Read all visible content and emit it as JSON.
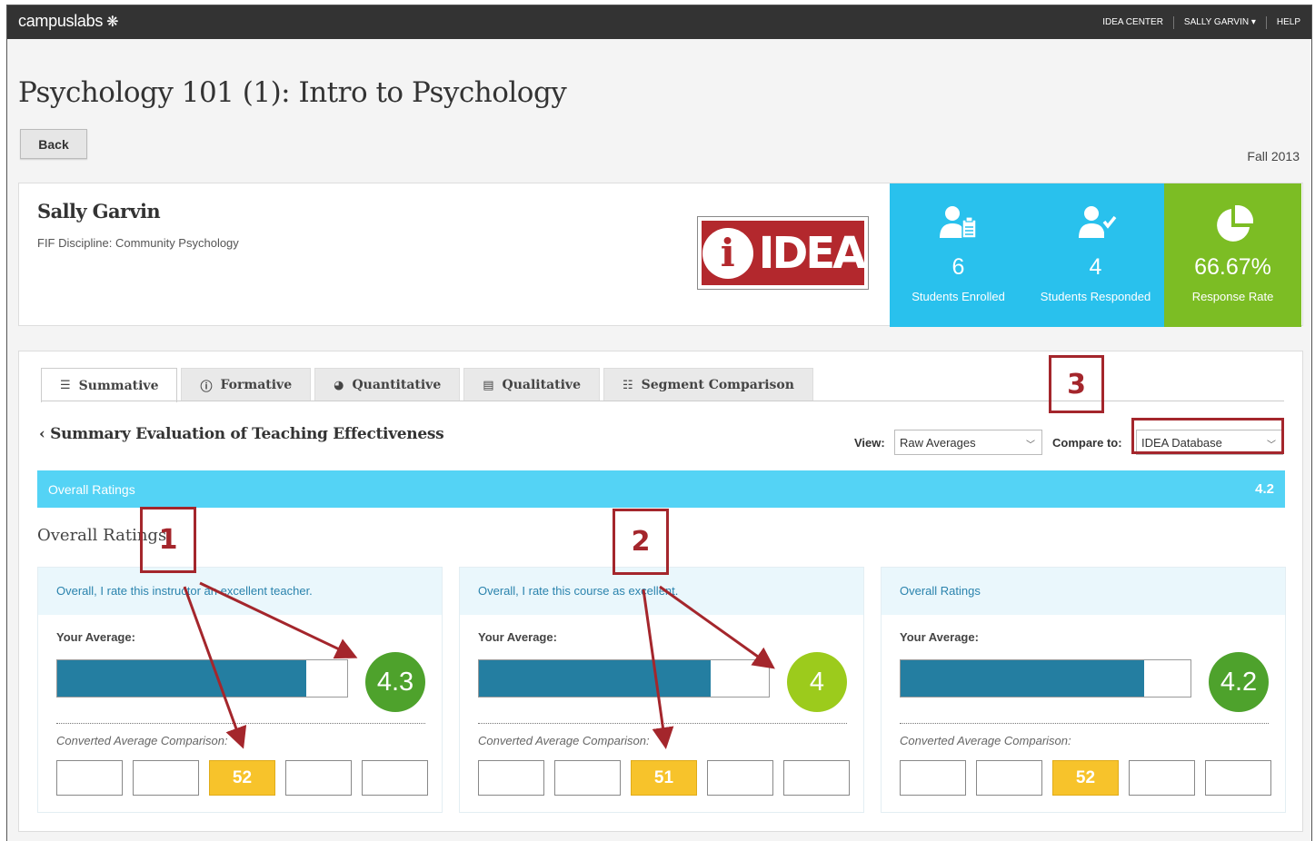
{
  "topbar": {
    "brand": "campuslabs",
    "nav": [
      "IDEA CENTER",
      "SALLY GARVIN ▾",
      "HELP"
    ]
  },
  "page": {
    "title": "Psychology 101 (1): Intro to Psychology",
    "back_label": "Back",
    "term": "Fall 2013"
  },
  "instructor": {
    "name": "Sally Garvin",
    "discipline": "FIF Discipline: Community Psychology",
    "logo_text": "IDEA",
    "logo_letter": "i"
  },
  "stats": [
    {
      "value": "6",
      "label": "Students Enrolled",
      "color": "#29c1ed",
      "icon": "user-clipboard-icon"
    },
    {
      "value": "4",
      "label": "Students Responded",
      "color": "#29c1ed",
      "icon": "user-check-icon"
    },
    {
      "value": "66.67%",
      "label": "Response Rate",
      "color": "#7cbd24",
      "icon": "pie-chart-icon"
    }
  ],
  "tabs": [
    {
      "label": "Summative",
      "icon": "bar-list-icon",
      "glyph": "☰",
      "active": true
    },
    {
      "label": "Formative",
      "icon": "info-icon",
      "glyph": "ⓘ",
      "active": false
    },
    {
      "label": "Quantitative",
      "icon": "pie-icon",
      "glyph": "◕",
      "active": false
    },
    {
      "label": "Qualitative",
      "icon": "document-icon",
      "glyph": "▤",
      "active": false
    },
    {
      "label": "Segment Comparison",
      "icon": "sliders-icon",
      "glyph": "☷",
      "active": false
    }
  ],
  "section": {
    "title": "Summary Evaluation of Teaching Effectiveness",
    "view_label": "View:",
    "view_value": "Raw Averages",
    "compare_label": "Compare to:",
    "compare_value": "IDEA Database"
  },
  "callouts": [
    "1",
    "2",
    "3"
  ],
  "overall_bar": {
    "label": "Overall Ratings",
    "value": "4.2"
  },
  "overall_heading": "Overall Ratings",
  "panels": [
    {
      "question": "Overall, I rate this instructor an excellent teacher.",
      "your_avg_label": "Your Average:",
      "bar_fraction": 0.86,
      "score": "4.3",
      "score_color": "#4ea22c",
      "comparison_label": "Converted Average Comparison:",
      "comparison_value": "52",
      "comparison_index": 2
    },
    {
      "question": "Overall, I rate this course as excellent.",
      "your_avg_label": "Your Average:",
      "bar_fraction": 0.8,
      "score": "4",
      "score_color": "#9ccb1c",
      "comparison_label": "Converted Average Comparison:",
      "comparison_value": "51",
      "comparison_index": 2
    },
    {
      "question": "Overall Ratings",
      "your_avg_label": "Your Average:",
      "bar_fraction": 0.84,
      "score": "4.2",
      "score_color": "#4ea22c",
      "comparison_label": "Converted Average Comparison:",
      "comparison_value": "52",
      "comparison_index": 2
    }
  ],
  "colors": {
    "accent_blue": "#29c1ed",
    "bar_blue": "#247ea1",
    "highlight_yellow": "#f7c32b",
    "callout_red": "#a4262c"
  }
}
